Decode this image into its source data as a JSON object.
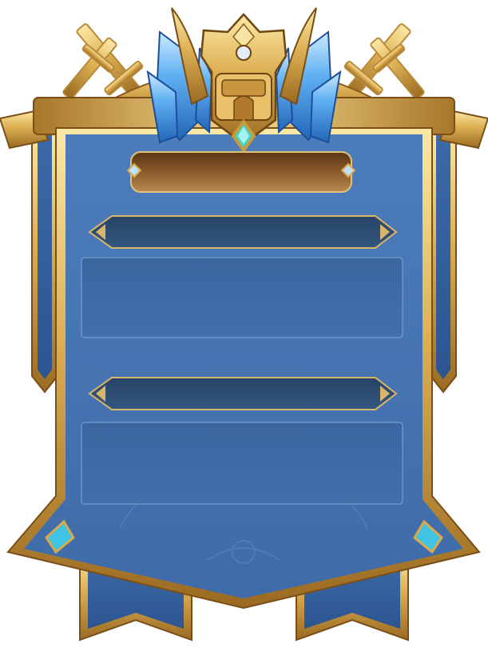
{
  "banner": {
    "title": "",
    "section_1_header": "",
    "section_1_body": "",
    "section_2_header": "",
    "section_2_body": ""
  },
  "colors": {
    "gold_light": "#f6dc8c",
    "gold_mid": "#d9a94a",
    "gold_dark": "#8a5a1c",
    "banner_blue": "#4a78b4",
    "banner_blue_dark": "#2f5a92",
    "slot_dark": "#2c4a70",
    "panel_blue": "#3d6aa6",
    "title_plate": "#7a4c22",
    "crystal_blue": "#4fa3f0",
    "gem_teal": "#3fd6c9"
  },
  "icons": {
    "crest": "trophy-crest-icon",
    "swords": "crossed-swords-icon",
    "crystals": "crystal-wings-icon",
    "gem": "diamond-gem-icon"
  }
}
